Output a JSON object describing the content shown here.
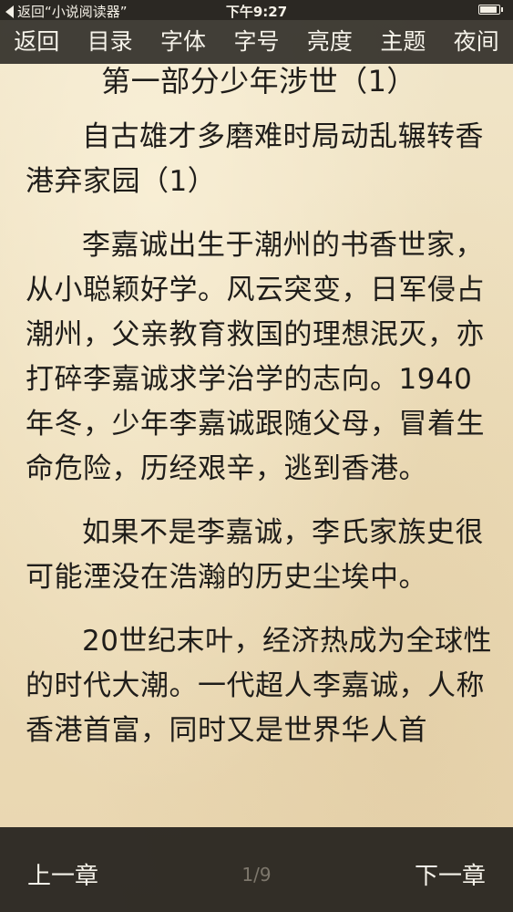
{
  "status_bar": {
    "back_label": "返回“小说阅读器”",
    "time": "下午9:27"
  },
  "top_menu": {
    "items": [
      {
        "label": "返回"
      },
      {
        "label": "目录"
      },
      {
        "label": "字体"
      },
      {
        "label": "字号"
      },
      {
        "label": "亮度"
      },
      {
        "label": "主题"
      },
      {
        "label": "夜间"
      }
    ]
  },
  "content": {
    "chapter_title": "第一部分少年涉世（1）",
    "paragraphs": [
      "自古雄才多磨难时局动乱辗转香港弃家园（1）",
      "李嘉诚出生于潮州的书香世家，从小聪颖好学。风云突变，日军侵占潮州，父亲教育救国的理想泯灭，亦打碎李嘉诚求学治学的志向。1940年冬，少年李嘉诚跟随父母，冒着生命危险，历经艰辛，逃到香港。",
      "如果不是李嘉诚，李氏家族史很可能湮没在浩瀚的历史尘埃中。",
      "20世纪末叶，经济热成为全球性的时代大潮。一代超人李嘉诚，人称香港首富，同时又是世界华人首"
    ]
  },
  "bottom_bar": {
    "prev_label": "上一章",
    "page_indicator": "1/9",
    "next_label": "下一章"
  }
}
